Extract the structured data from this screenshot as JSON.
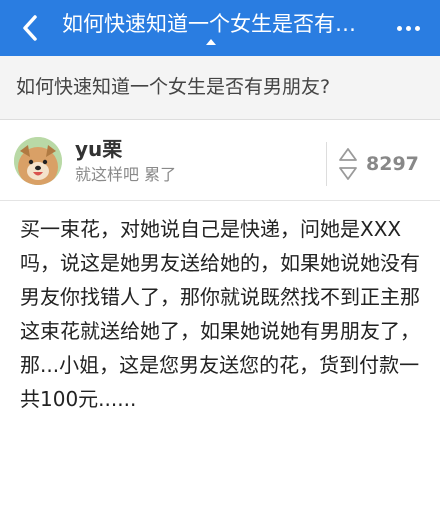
{
  "navbar": {
    "title": "如何快速知道一个女生是否有男朋友?",
    "back_icon": "chevron-left-icon",
    "more_icon": "more-dots-icon",
    "background_color": "#2a7de1"
  },
  "question": {
    "title": "如何快速知道一个女生是否有男朋友?"
  },
  "answer": {
    "author_name": "yu栗",
    "author_bio": "就这样吧 累了",
    "vote_count": "8297",
    "body": "买一束花，对她说自己是快递，问她是XXX吗，说这是她男友送给她的，如果她说她没有男友你找错人了，那你就说既然找不到正主那这束花就送给她了，如果她说她有男朋友了，那...小姐，这是您男友送您的花，货到付款一共100元......"
  }
}
